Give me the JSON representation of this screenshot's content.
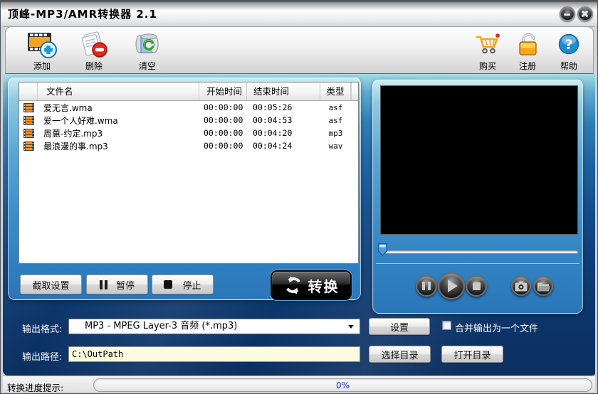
{
  "window": {
    "title": "顶峰-MP3/AMR转换器 2.1"
  },
  "toolbar": {
    "add": "添加",
    "delete": "删除",
    "clear": "清空",
    "buy": "购买",
    "register": "注册",
    "help": "帮助"
  },
  "file_list": {
    "columns": [
      "文件名",
      "开始时间",
      "结束时间",
      "类型"
    ],
    "rows": [
      {
        "name": "爱无言.wma",
        "start": "00:00:00",
        "end": "00:05:26",
        "type": "asf"
      },
      {
        "name": "爱一个人好难.wma",
        "start": "00:00:00",
        "end": "00:04:53",
        "type": "asf"
      },
      {
        "name": "周蕙-约定.mp3",
        "start": "00:00:00",
        "end": "00:04:20",
        "type": "mp3"
      },
      {
        "name": "最浪漫的事.mp3",
        "start": "00:00:00",
        "end": "00:04:24",
        "type": "wav"
      }
    ]
  },
  "actions": {
    "capture_settings": "截取设置",
    "pause": "暂停",
    "stop": "停止",
    "convert": "转换"
  },
  "output": {
    "format_label": "输出格式:",
    "format_value": "MP3 - MPEG Layer-3 音频 (*.mp3)",
    "settings": "设置",
    "merge_label": "合并输出为一个文件",
    "merge_checked": false,
    "path_label": "输出路径:",
    "path_value": "C:\\OutPath",
    "choose_dir": "选择目录",
    "open_dir": "打开目录"
  },
  "status": {
    "label": "转换进度提示:",
    "progress_text": "0%",
    "progress_percent": 0
  },
  "colors": {
    "panel_blue": "#3d8dc9",
    "background_navy": "#0d3a72",
    "path_field_bg": "#fbfbdf",
    "progress_text_blue": "#1535c0",
    "film_orange": "#f7941d",
    "convert_button_black": "#000000"
  }
}
